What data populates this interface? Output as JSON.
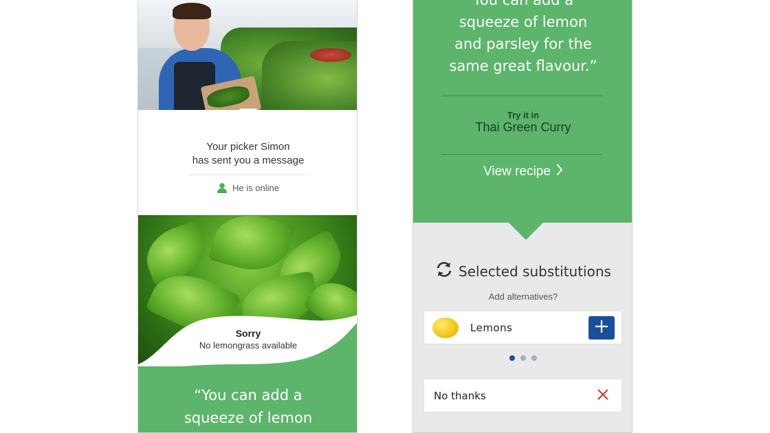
{
  "left_screen": {
    "message": {
      "line1": "Your picker Simon",
      "line2": "has sent you a message"
    },
    "status": "He is online",
    "sorry": {
      "title": "Sorry",
      "subtitle": "No lemongrass available"
    },
    "quote": {
      "line1": "“You can add a",
      "line2": "squeeze of lemon"
    }
  },
  "right_screen": {
    "quote": "You can add a\nsqueeze of lemon\nand parsley for the\nsame great flavour.”",
    "try_it": {
      "label": "Try it in",
      "recipe": "Thai Green Curry"
    },
    "view_recipe": "View recipe",
    "substitutions": {
      "title": "Selected substitutions",
      "prompt": "Add alternatives?",
      "items": [
        {
          "name": "Lemons",
          "icon": "lemon-image"
        }
      ],
      "carousel": {
        "pages": 3,
        "active": 1
      },
      "no_thanks": "No thanks"
    }
  },
  "colors": {
    "green": "#5db46b",
    "blue": "#1b4f9c",
    "red": "#d9373f",
    "grey_bg": "#e9e9e9"
  }
}
